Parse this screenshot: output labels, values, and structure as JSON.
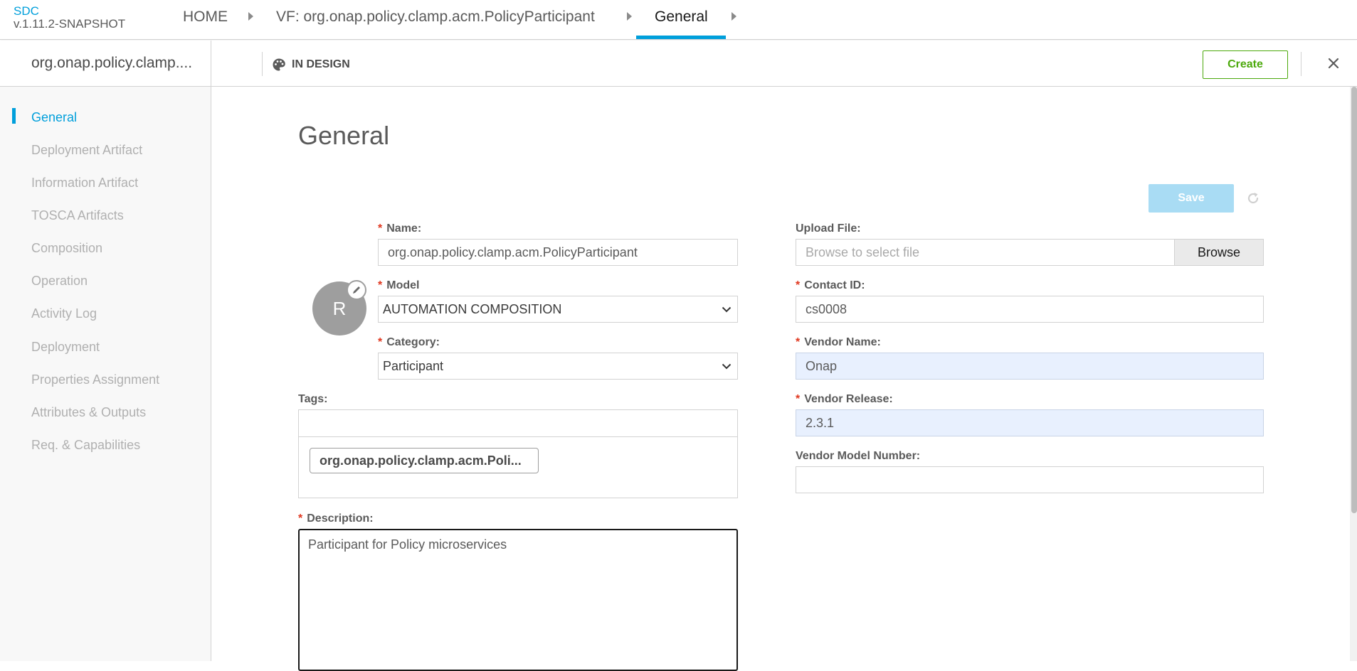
{
  "brand": {
    "name": "SDC",
    "version": "v.1.11.2-SNAPSHOT"
  },
  "breadcrumbs": [
    {
      "label": "HOME"
    },
    {
      "label": "VF: org.onap.policy.clamp.acm.PolicyParticipant"
    },
    {
      "label": "General"
    }
  ],
  "header": {
    "component_name": "org.onap.policy.clamp....",
    "status": "IN DESIGN",
    "create_label": "Create"
  },
  "sidebar": {
    "items": [
      {
        "label": "General",
        "active": true
      },
      {
        "label": "Deployment Artifact"
      },
      {
        "label": "Information Artifact"
      },
      {
        "label": "TOSCA Artifacts"
      },
      {
        "label": "Composition"
      },
      {
        "label": "Operation"
      },
      {
        "label": "Activity Log"
      },
      {
        "label": "Deployment"
      },
      {
        "label": "Properties Assignment"
      },
      {
        "label": "Attributes & Outputs"
      },
      {
        "label": "Req. & Capabilities"
      }
    ]
  },
  "main": {
    "heading": "General",
    "save_label": "Save",
    "avatar_letter": "R",
    "name": {
      "label": "Name:",
      "value": "org.onap.policy.clamp.acm.PolicyParticipant"
    },
    "model": {
      "label": "Model",
      "value": "AUTOMATION COMPOSITION"
    },
    "category": {
      "label": "Category:",
      "value": "Participant"
    },
    "tags": {
      "label": "Tags:",
      "chip": "org.onap.policy.clamp.acm.Poli..."
    },
    "description": {
      "label": "Description:",
      "value": "Participant for Policy microservices"
    },
    "upload": {
      "label": "Upload File:",
      "placeholder": "Browse to select file",
      "browse_label": "Browse"
    },
    "contact_id": {
      "label": "Contact ID:",
      "value": "cs0008"
    },
    "vendor_name": {
      "label": "Vendor Name:",
      "value": "Onap"
    },
    "vendor_release": {
      "label": "Vendor Release:",
      "value": "2.3.1"
    },
    "vendor_model_number": {
      "label": "Vendor Model Number:",
      "value": ""
    }
  },
  "colors": {
    "accent": "#009fdb",
    "create_green": "#4ca90c",
    "required_red": "#e0371f",
    "save_disabled": "#a9dcf4"
  }
}
